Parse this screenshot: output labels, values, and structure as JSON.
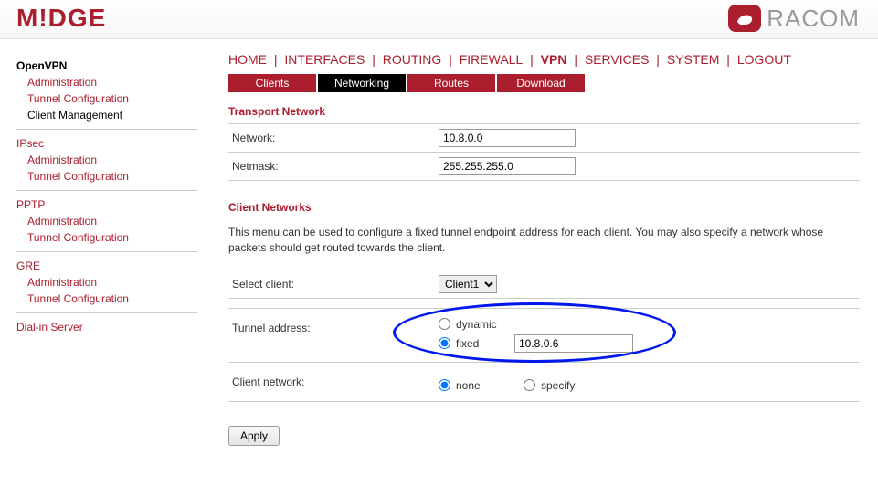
{
  "header": {
    "brand_left": "M!DGE",
    "brand_right": "RACOM"
  },
  "topnav": {
    "items": [
      "HOME",
      "INTERFACES",
      "ROUTING",
      "FIREWALL",
      "VPN",
      "SERVICES",
      "SYSTEM",
      "LOGOUT"
    ],
    "active": "VPN"
  },
  "tabs": {
    "items": [
      "Clients",
      "Networking",
      "Routes",
      "Download"
    ],
    "active": "Networking"
  },
  "sidebar": [
    {
      "head": "OpenVPN",
      "head_style": "bold-black",
      "subs": [
        {
          "label": "Administration",
          "active": false
        },
        {
          "label": "Tunnel Configuration",
          "active": false
        },
        {
          "label": "Client Management",
          "active": true
        }
      ]
    },
    {
      "head": "IPsec",
      "subs": [
        {
          "label": "Administration"
        },
        {
          "label": "Tunnel Configuration"
        }
      ]
    },
    {
      "head": "PPTP",
      "subs": [
        {
          "label": "Administration"
        },
        {
          "label": "Tunnel Configuration"
        }
      ]
    },
    {
      "head": "GRE",
      "subs": [
        {
          "label": "Administration"
        },
        {
          "label": "Tunnel Configuration"
        }
      ]
    },
    {
      "head": "Dial-in Server",
      "subs": []
    }
  ],
  "transport": {
    "title": "Transport Network",
    "network_label": "Network:",
    "network_value": "10.8.0.0",
    "netmask_label": "Netmask:",
    "netmask_value": "255.255.255.0"
  },
  "client_nets": {
    "title": "Client Networks",
    "desc": "This menu can be used to configure a fixed tunnel endpoint address for each client. You may also specify a network whose packets should get routed towards the client.",
    "select_label": "Select client:",
    "select_value": "Client1",
    "tunnel_label": "Tunnel address:",
    "tunnel_dynamic": "dynamic",
    "tunnel_fixed": "fixed",
    "tunnel_fixed_value": "10.8.0.6",
    "tunnel_selected": "fixed",
    "clientnet_label": "Client network:",
    "clientnet_none": "none",
    "clientnet_specify": "specify",
    "clientnet_selected": "none"
  },
  "apply_label": "Apply"
}
